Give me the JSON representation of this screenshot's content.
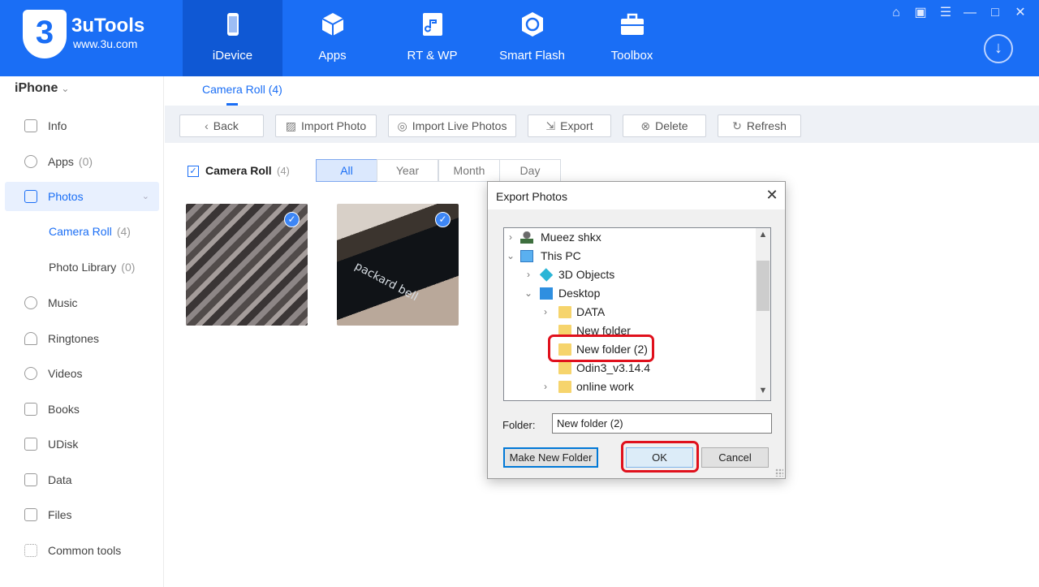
{
  "app": {
    "name": "3uTools",
    "url": "www.3u.com",
    "logo_glyph": "3"
  },
  "nav": [
    {
      "label": "iDevice",
      "icon": "phone-icon",
      "active": true
    },
    {
      "label": "Apps",
      "icon": "cube-icon",
      "active": false
    },
    {
      "label": "RT & WP",
      "icon": "music-file-icon",
      "active": false
    },
    {
      "label": "Smart Flash",
      "icon": "flash-icon",
      "active": false
    },
    {
      "label": "Toolbox",
      "icon": "toolbox-icon",
      "active": false
    }
  ],
  "window_controls": [
    "shirt-icon",
    "note-icon",
    "menu-icon",
    "minimize-icon",
    "maximize-icon",
    "close-icon"
  ],
  "download_icon": "download-icon",
  "sidebar": {
    "device": "iPhone",
    "items": [
      {
        "label": "Info",
        "count": "",
        "icon": "info-icon"
      },
      {
        "label": "Apps",
        "count": "(0)",
        "icon": "apps-icon"
      },
      {
        "label": "Photos",
        "count": "",
        "icon": "photos-icon",
        "active": true
      },
      {
        "label": "Music",
        "count": "",
        "icon": "music-icon"
      },
      {
        "label": "Ringtones",
        "count": "",
        "icon": "bell-icon"
      },
      {
        "label": "Videos",
        "count": "",
        "icon": "video-icon"
      },
      {
        "label": "Books",
        "count": "",
        "icon": "book-icon"
      },
      {
        "label": "UDisk",
        "count": "",
        "icon": "udisk-icon"
      },
      {
        "label": "Data",
        "count": "",
        "icon": "data-icon"
      },
      {
        "label": "Files",
        "count": "",
        "icon": "folder-icon"
      },
      {
        "label": "Common tools",
        "count": "",
        "icon": "grid-icon"
      }
    ],
    "photo_sub": [
      {
        "label": "Camera Roll",
        "count": "(4)",
        "active": true
      },
      {
        "label": "Photo Library",
        "count": "(0)",
        "active": false
      }
    ]
  },
  "tabs": {
    "camera_roll": "Camera Roll (4)"
  },
  "toolbar": {
    "back": "Back",
    "import_photo": "Import Photo",
    "import_live": "Import Live Photos",
    "export": "Export",
    "delete": "Delete",
    "refresh": "Refresh"
  },
  "filter": {
    "label": "Camera Roll",
    "count": "(4)",
    "segments": [
      "All",
      "Year",
      "Month",
      "Day"
    ],
    "active": "All"
  },
  "thumbnails": [
    {
      "desc_icon": "photo-thumbnail",
      "selected": true
    },
    {
      "desc_icon": "photo-thumbnail",
      "selected": true,
      "text": "packard bell"
    }
  ],
  "dialog": {
    "title": "Export Photos",
    "tree": [
      {
        "label": "Mueez shkx",
        "level": 0,
        "expander": ">",
        "icon": "user-icon"
      },
      {
        "label": "This PC",
        "level": 0,
        "expander": "v",
        "icon": "pc-icon"
      },
      {
        "label": "3D Objects",
        "level": 1,
        "expander": ">",
        "icon": "3d-objects-icon"
      },
      {
        "label": "Desktop",
        "level": 1,
        "expander": "v",
        "icon": "desktop-icon"
      },
      {
        "label": "DATA",
        "level": 2,
        "expander": ">",
        "icon": "folder-icon"
      },
      {
        "label": "New folder",
        "level": 2,
        "expander": "",
        "icon": "folder-icon"
      },
      {
        "label": "New folder (2)",
        "level": 2,
        "expander": "",
        "icon": "folder-icon",
        "selected": true
      },
      {
        "label": "Odin3_v3.14.4",
        "level": 2,
        "expander": "",
        "icon": "folder-icon"
      },
      {
        "label": "online work",
        "level": 2,
        "expander": ">",
        "icon": "folder-icon"
      }
    ],
    "folder_label": "Folder:",
    "folder_value": "New folder (2)",
    "make_new_folder": "Make New Folder",
    "ok": "OK",
    "cancel": "Cancel"
  },
  "colors": {
    "brand": "#1a6ef5",
    "highlight": "#e0101c"
  }
}
